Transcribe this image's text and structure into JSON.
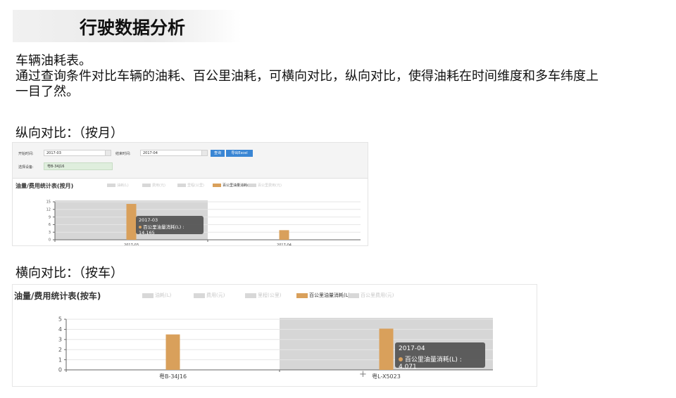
{
  "header": {
    "title": "行驶数据分析"
  },
  "intro": {
    "line1": "车辆油耗表。",
    "line2": "通过查询条件对比车辆的油耗、百公里油耗，可横向对比，纵向对比，使得油耗在时间维度和多车纬度上",
    "line3": "一目了然。"
  },
  "vertical": {
    "label": "纵向对比：（按月）",
    "form": {
      "start_label": "开始时间:",
      "start_value": "2017-03",
      "end_label": "结束时间:",
      "end_value": "2017-04",
      "query_button": "查询",
      "export_button": "导出Excel",
      "vehicle_label": "选择设备:",
      "vehicle_value": "粤B-34J16"
    },
    "chart_title": "油量/费用统计表(按月)",
    "legend": [
      "油耗(L)",
      "费用(元)",
      "里程(公里)",
      "百公里油量消耗(L)",
      "百公里费用(元)"
    ],
    "tooltip": {
      "title": "2017-03",
      "series": "百公里油量消耗(L)",
      "value": "14.165"
    }
  },
  "horizontal": {
    "label": "横向对比：（按车）",
    "chart_title": "油量/费用统计表(按车)",
    "legend": [
      "油耗(L)",
      "费用(元)",
      "里程(公里)",
      "百公里油量消耗(L)",
      "百公里费用(元)"
    ],
    "tooltip": {
      "title": "2017-04",
      "series": "百公里油量消耗(L)",
      "value": "4.071"
    }
  },
  "colors": {
    "bar": "#d9a05b",
    "highlight": "#d6d6d6",
    "legend_off": "#d8d8d8",
    "button": "#3a86d4"
  },
  "chart_data": [
    {
      "type": "bar",
      "title": "油量/费用统计表(按月)",
      "categories": [
        "2017-03",
        "2017-04"
      ],
      "series": [
        {
          "name": "百公里油量消耗(L)",
          "values": [
            14.165,
            3.8
          ]
        }
      ],
      "ylim": [
        0,
        15
      ],
      "yticks": [
        0,
        3,
        6,
        9,
        12,
        15
      ],
      "highlight_category": 0,
      "grid": true
    },
    {
      "type": "bar",
      "title": "油量/费用统计表(按车)",
      "categories": [
        "粤B-34J16",
        "粤L-X5023"
      ],
      "series": [
        {
          "name": "百公里油量消耗(L)",
          "values": [
            3.5,
            4.071
          ]
        }
      ],
      "ylim": [
        0,
        5
      ],
      "yticks": [
        0,
        1,
        2,
        3,
        4,
        5
      ],
      "highlight_category": 1,
      "grid": true
    }
  ]
}
